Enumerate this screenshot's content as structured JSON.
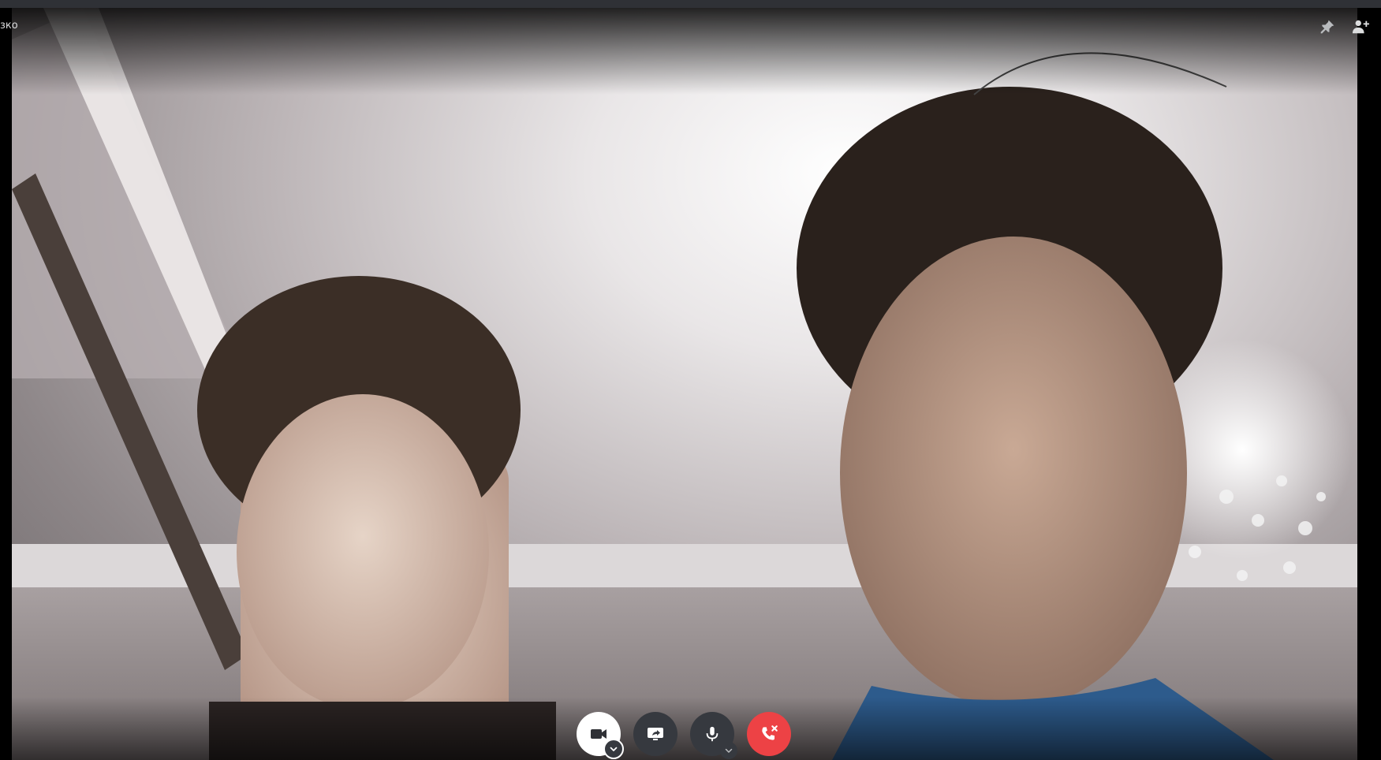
{
  "window": {
    "channel_name": "зко"
  },
  "top_actions": {
    "pin_icon": "pin-icon",
    "add_friend_icon": "add-friend-icon"
  },
  "call_controls": [
    {
      "name": "camera-button",
      "icon": "camera-icon",
      "state": "on",
      "has_options": true
    },
    {
      "name": "screen-share-button",
      "icon": "screen-share-icon",
      "state": "off",
      "has_options": false
    },
    {
      "name": "microphone-button",
      "icon": "microphone-icon",
      "state": "off",
      "has_options": true
    },
    {
      "name": "disconnect-button",
      "icon": "hang-up-icon",
      "state": "danger",
      "has_options": false
    }
  ],
  "colors": {
    "background": "#000000",
    "control_dark": "#36393f",
    "control_light": "#ffffff",
    "disconnect_red": "#ed4245",
    "text": "#dcddde"
  }
}
